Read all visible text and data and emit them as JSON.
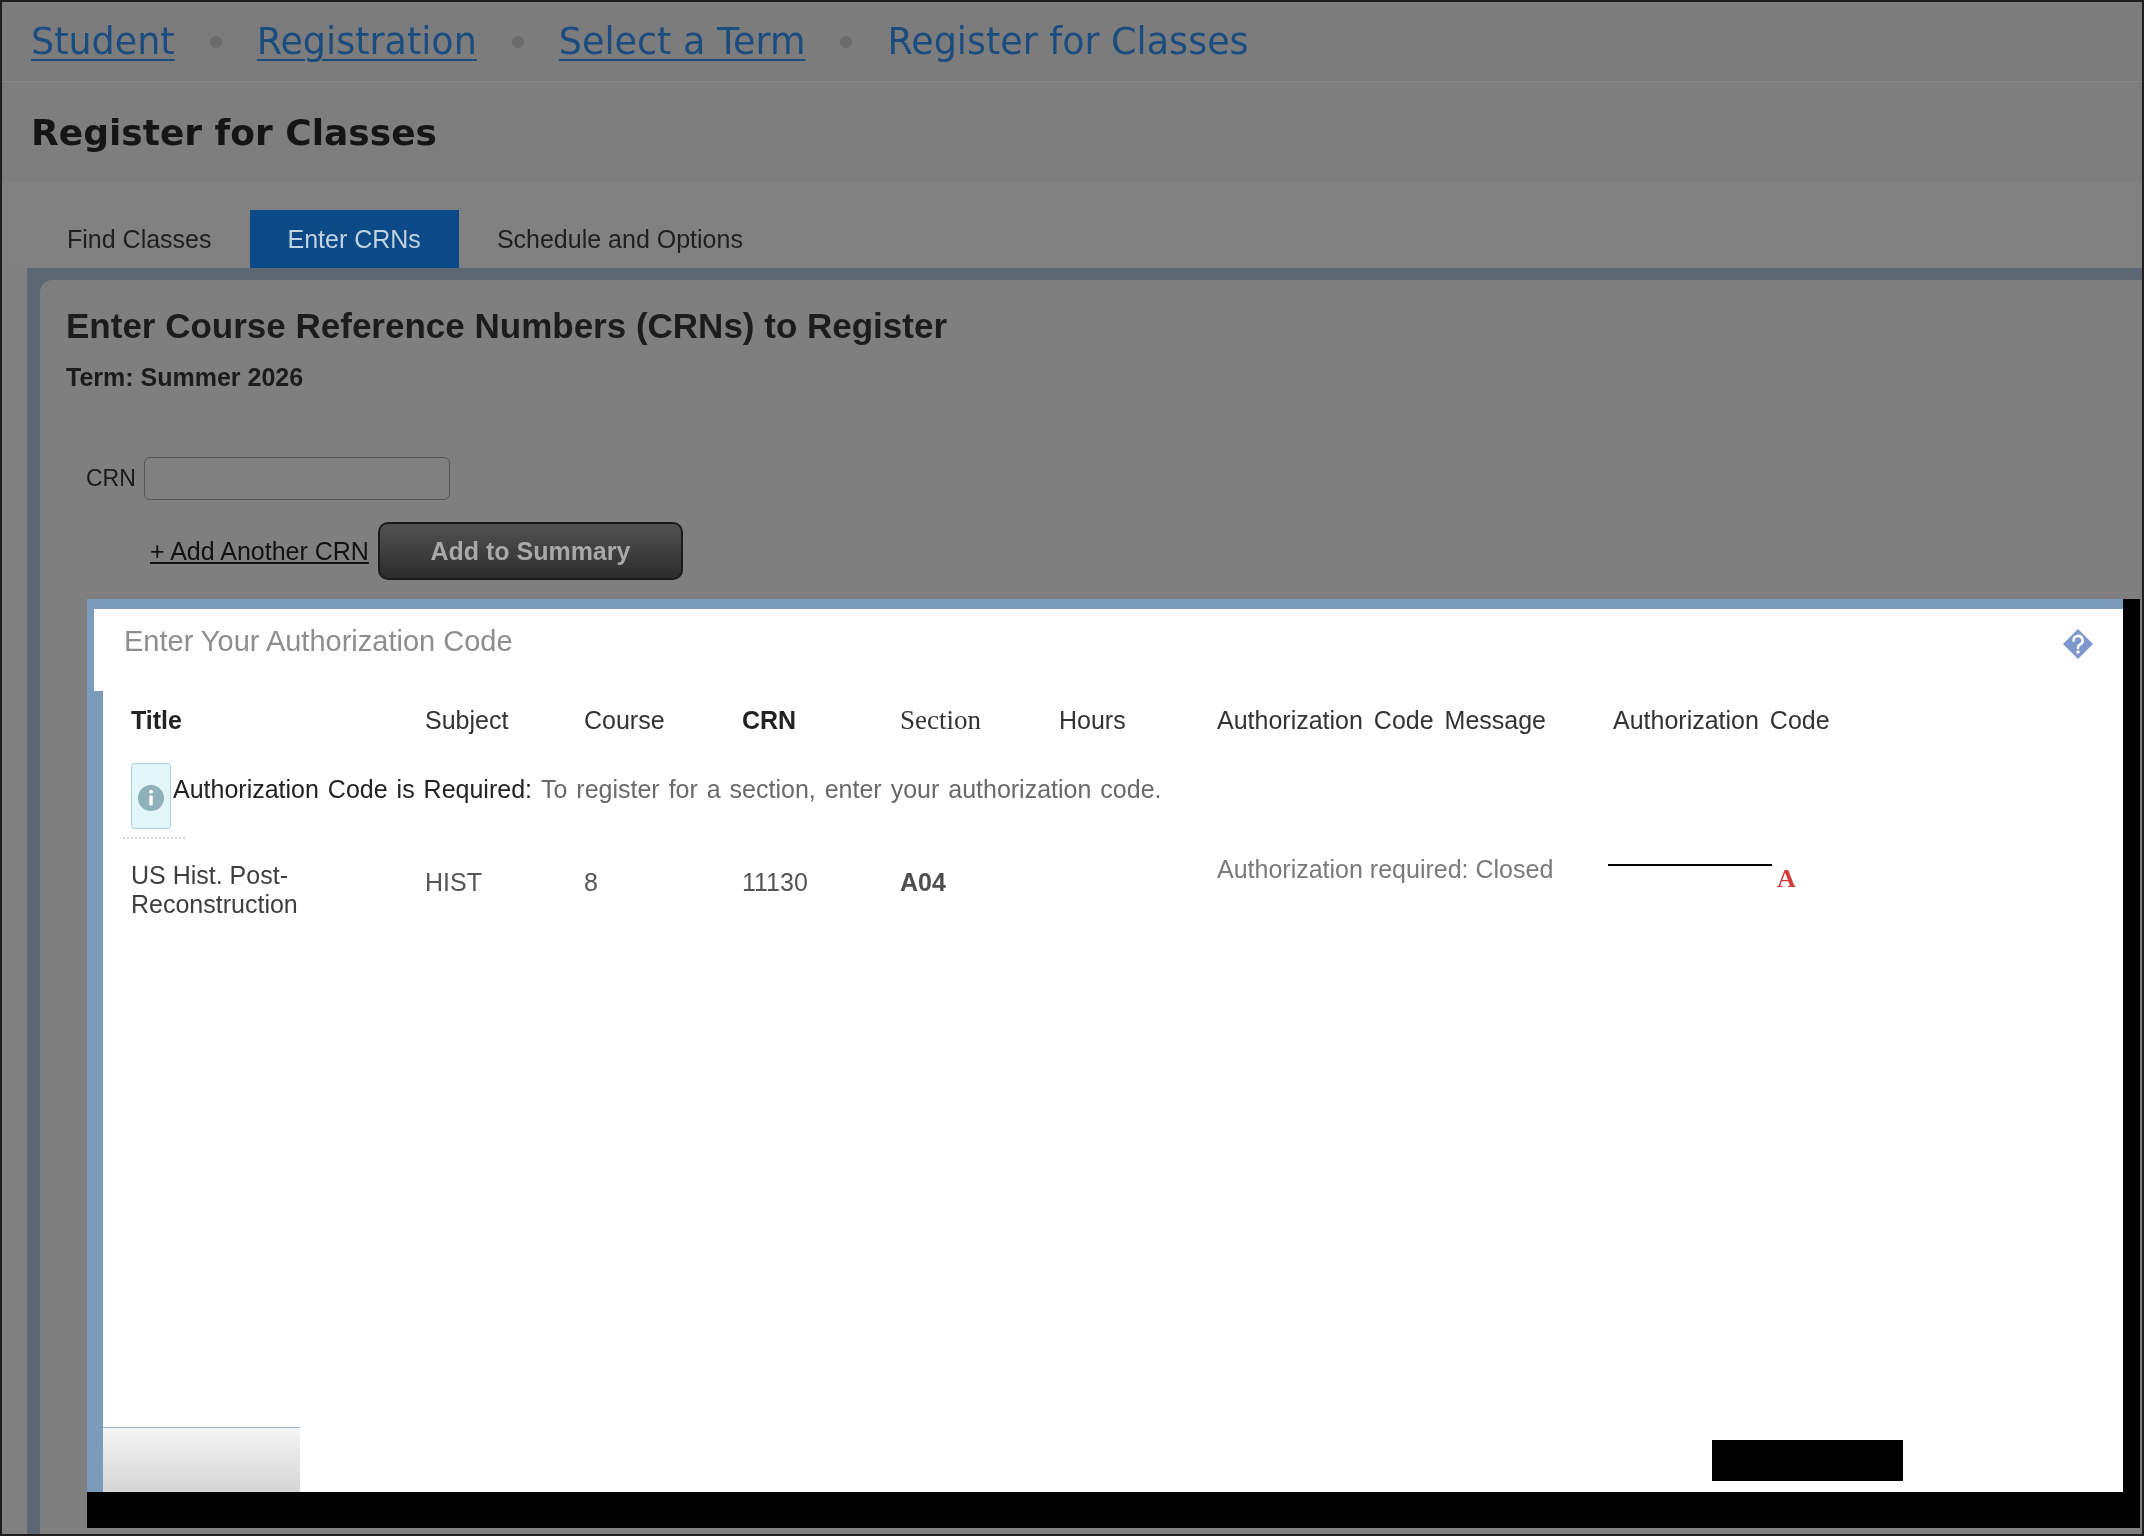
{
  "breadcrumb": [
    {
      "label": "Student",
      "kind": "link"
    },
    {
      "label": "Registration",
      "kind": "link"
    },
    {
      "label": "Select a Term",
      "kind": "link"
    },
    {
      "label": "Register for Classes",
      "kind": "current"
    }
  ],
  "page_title": "Register for Classes",
  "tabs": [
    {
      "label": "Find Classes",
      "selected": false
    },
    {
      "label": "Enter CRNs",
      "selected": true
    },
    {
      "label": "Schedule and Options",
      "selected": false
    }
  ],
  "panel": {
    "heading": "Enter Course Reference Numbers (CRNs) to Register",
    "term": "Term: Summer 2026",
    "crn_field": {
      "label": "CRN"
    },
    "add_link": "+ Add Another CRN",
    "submit_button": "Add to Summary"
  },
  "dialog": {
    "title": "Enter Your Authorization Code",
    "table": {
      "columns": [
        {
          "label": "Title",
          "kind": "bold"
        },
        {
          "label": "Subject",
          "kind": "plain"
        },
        {
          "label": "Course",
          "kind": "plain"
        },
        {
          "label": "CRN",
          "kind": "bold"
        },
        {
          "label": "Section",
          "kind": "serif"
        },
        {
          "label": "Hours",
          "kind": "plain"
        },
        {
          "label": "Authorization Code Message",
          "kind": "plain"
        },
        {
          "label": "Authorization Code",
          "kind": "plain"
        }
      ],
      "notice": {
        "title": "Authorization Code is Required:",
        "text": "To register for a section, enter your authorization code."
      },
      "rows": [
        {
          "title": "US Hist. Post-Reconstruction",
          "subject": "HIST",
          "course": "8",
          "crn": "11130",
          "section": "A04",
          "message": "Authorization required: Closed",
          "code_mark": "A"
        }
      ]
    }
  }
}
